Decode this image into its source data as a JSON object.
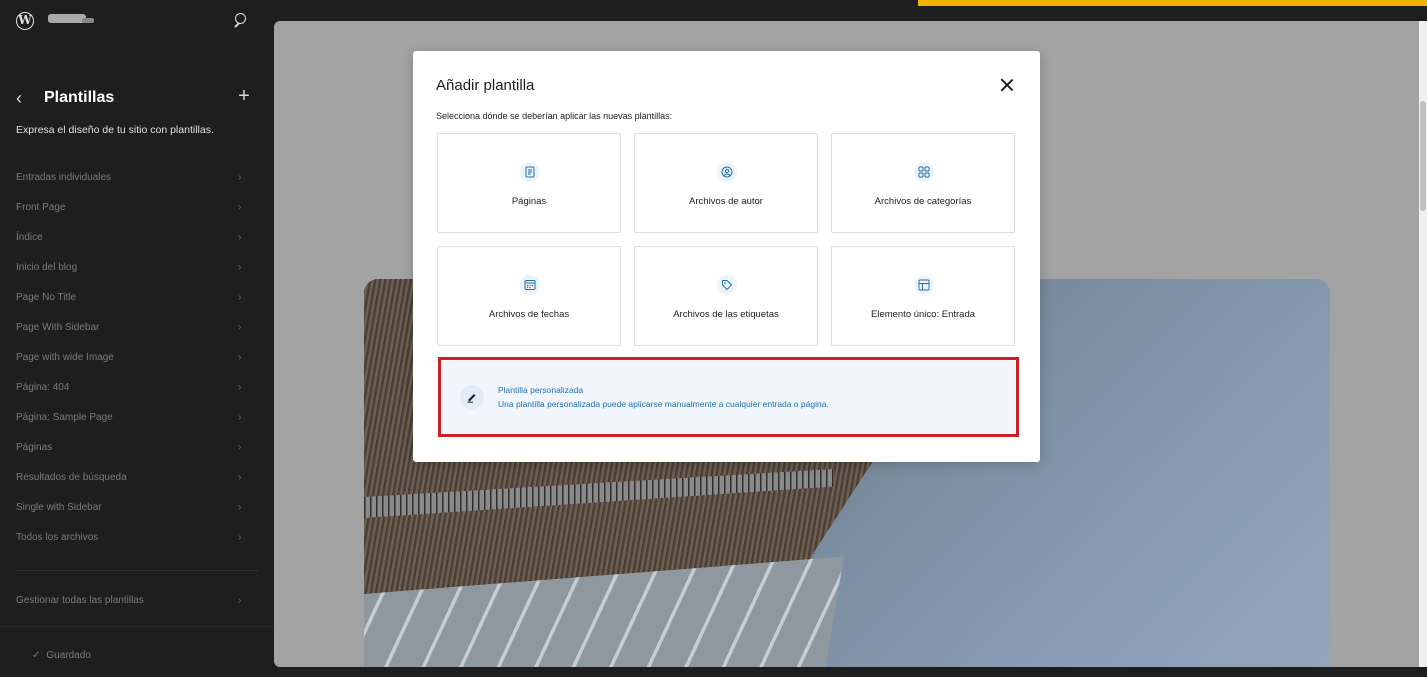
{
  "topbar": {
    "accent_color": "#f0b400"
  },
  "sidebar": {
    "title": "Plantillas",
    "description": "Expresa el diseño de tu sitio con plantillas.",
    "items": [
      {
        "label": "Entradas individuales"
      },
      {
        "label": "Front Page"
      },
      {
        "label": "Índice"
      },
      {
        "label": "Inicio del blog"
      },
      {
        "label": "Page No Title"
      },
      {
        "label": "Page With Sidebar"
      },
      {
        "label": "Page with wide Image"
      },
      {
        "label": "Página: 404"
      },
      {
        "label": "Página: Sample Page"
      },
      {
        "label": "Páginas"
      },
      {
        "label": "Resultados de búsqueda"
      },
      {
        "label": "Single with Sidebar"
      },
      {
        "label": "Todos los archivos"
      }
    ],
    "manage_label": "Gestionar todas las plantillas",
    "saved_label": "Guardado"
  },
  "modal": {
    "title": "Añadir plantilla",
    "description": "Selecciona dónde se deberían aplicar las nuevas plantillas:",
    "options": [
      {
        "label": "Páginas",
        "icon": "page-icon"
      },
      {
        "label": "Archivos de autor",
        "icon": "author-icon"
      },
      {
        "label": "Archivos de categorías",
        "icon": "category-icon"
      },
      {
        "label": "Archivos de fechas",
        "icon": "calendar-icon"
      },
      {
        "label": "Archivos de las etiquetas",
        "icon": "tag-icon"
      },
      {
        "label": "Elemento único: Entrada",
        "icon": "layout-icon"
      }
    ],
    "custom": {
      "title": "Plantilla personalizada",
      "subtitle": "Una plantilla personalizada puede aplicarse manualmente a cualquier entrada o página.",
      "icon": "pencil-icon"
    },
    "highlight_color": "#cc1f28",
    "link_color": "#2271b1"
  }
}
